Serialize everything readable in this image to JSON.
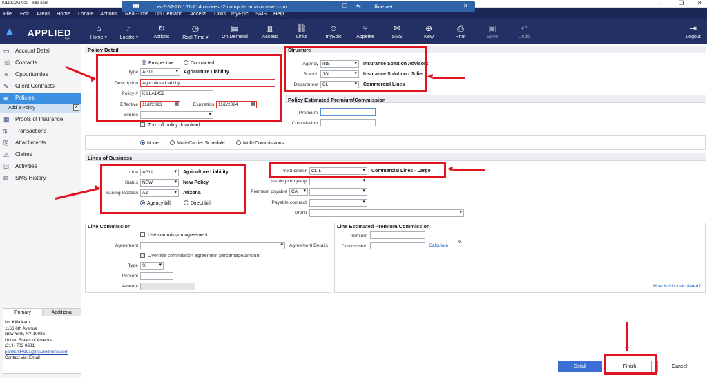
{
  "window": {
    "title": "KILLKOM-000 - killa kom",
    "remote_host": "ec2-52-26-161-214.us-west-2.compute.amazonaws.com",
    "remote_suffix": "illine.net"
  },
  "menu": [
    "File",
    "Edit",
    "Areas",
    "Home",
    "Locate",
    "Actions",
    "Real-Time",
    "On Demand",
    "Access",
    "Links",
    "myEpic",
    "SMS",
    "Help"
  ],
  "brand": "APPLIED",
  "brand_sub": "Epic",
  "toolbar": [
    {
      "label": "Home ▾",
      "icon": "⌂"
    },
    {
      "label": "Locate ▾",
      "icon": "⌕"
    },
    {
      "label": "Actions",
      "icon": "↻"
    },
    {
      "label": "Real-Time ▾",
      "icon": "◷"
    },
    {
      "label": "On Demand",
      "icon": "▤"
    },
    {
      "label": "Access",
      "icon": "▥"
    },
    {
      "label": "Links",
      "icon": "⛓"
    },
    {
      "label": "myEpic",
      "icon": "☺"
    },
    {
      "label": "Appetite",
      "icon": "⑂"
    },
    {
      "label": "SMS",
      "icon": "✉"
    },
    {
      "label": "New",
      "icon": "⊕"
    },
    {
      "label": "Print",
      "icon": "⎙"
    },
    {
      "label": "Save",
      "icon": "▣"
    },
    {
      "label": "Undo",
      "icon": "↶"
    },
    {
      "label": "Logout",
      "icon": "⇥"
    }
  ],
  "sidebar": [
    {
      "label": "Account Detail",
      "icon": "▭"
    },
    {
      "label": "Contacts",
      "icon": "☏"
    },
    {
      "label": "Opportunities",
      "icon": "⚭"
    },
    {
      "label": "Client Contracts",
      "icon": "✎"
    },
    {
      "label": "Policies",
      "icon": "◈"
    },
    {
      "label": "Add a Policy",
      "icon": ""
    },
    {
      "label": "Proofs of Insurance",
      "icon": "▦"
    },
    {
      "label": "Transactions",
      "icon": "$"
    },
    {
      "label": "Attachments",
      "icon": "⎘"
    },
    {
      "label": "Claims",
      "icon": "⚠"
    },
    {
      "label": "Activities",
      "icon": "☑"
    },
    {
      "label": "SMS History",
      "icon": "✉"
    }
  ],
  "contact": {
    "tabs": [
      "Primary",
      "Additional"
    ],
    "lines": [
      "Mr. Killa kam",
      "1166 6th Avenue",
      "New York, NY  10036",
      "United States of America",
      "(214) 702-9691"
    ],
    "email": "parikshit+991@insuredmine.com",
    "contact_via": "Contact via: Email"
  },
  "policy_detail": {
    "title": "Policy Detail",
    "radio_prospective": "Prospective",
    "radio_contracted": "Contracted",
    "type_label": "Type",
    "type_value": "AGLI",
    "type_desc": "Agriculture Liability",
    "description_label": "Description",
    "description_value": "Agriculture Liability",
    "policy_no_label": "Policy #",
    "policy_no_value": "KILLA1452",
    "effective_label": "Effective",
    "effective_value": "11/8/2023",
    "expiration_label": "Expiration",
    "expiration_value": "11/8/2024",
    "source_label": "Source",
    "source_value": "",
    "turn_off": "Turn off policy download"
  },
  "structure": {
    "title": "Structure",
    "agency_label": "Agency",
    "agency_value": "INS",
    "agency_desc": "Insurance Solution Advisors",
    "branch_label": "Branch",
    "branch_value": "JOL",
    "branch_desc": "Insurance Solution - Joliet",
    "department_label": "Department",
    "department_value": "CL",
    "department_desc": "Commercial Lines"
  },
  "policy_est": {
    "title": "Policy Estimated Premium/Commission",
    "premium_label": "Premium",
    "commission_label": "Commission"
  },
  "multi": {
    "none": "None",
    "multi_carrier": "Multi-Carrier Schedule",
    "multi_comm": "Multi-Commissions"
  },
  "lob": {
    "title": "Lines of Business",
    "line_label": "Line",
    "line_value": "AGLI",
    "line_desc": "Agriculture Liability",
    "status_label": "Status",
    "status_value": "NEW",
    "status_desc": "New Policy",
    "issuing_label": "Issuing location",
    "issuing_value": "AZ",
    "issuing_desc": "Arizona",
    "agency_bill": "Agency bill",
    "direct_bill": "Direct bill",
    "profit_label": "Profit center",
    "profit_value": "CL-L",
    "profit_desc": "Commercial Lines - Large",
    "issuing_company_label": "Issuing company",
    "premium_payable_label": "Premium payable",
    "premium_payable_value": "CA",
    "payable_contract_label": "Payable contract",
    "prefill_label": "Prefill"
  },
  "line_comm": {
    "title": "Line Commission",
    "use_agreement": "Use commission agreement",
    "agreement_label": "Agreement",
    "agreement_details": "Agreement Details",
    "override": "Override commission agreement percentage/amount",
    "type_label": "Type",
    "type_value": "%",
    "percent_label": "Percent",
    "amount_label": "Amount"
  },
  "line_est": {
    "title": "Line Estimated Premium/Commission",
    "premium_label": "Premium",
    "commission_label": "Commission",
    "calculate": "Calculate",
    "how": "How is this calculated?"
  },
  "buttons": {
    "detail": "Detail",
    "finish": "Finish",
    "cancel": "Cancel"
  }
}
